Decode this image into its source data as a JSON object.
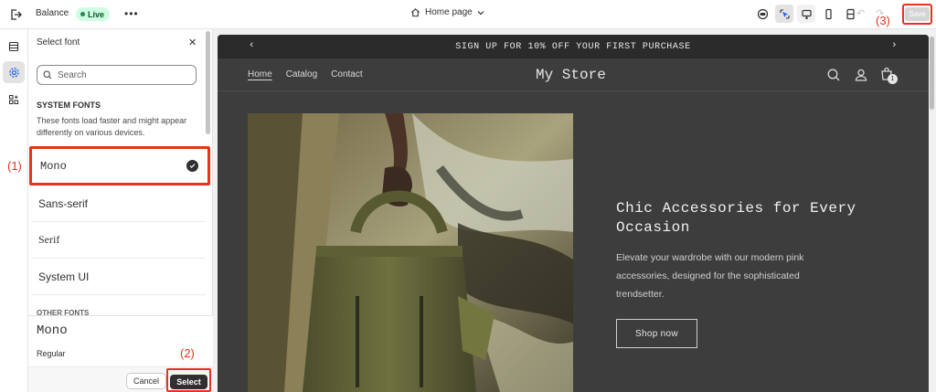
{
  "topbar": {
    "theme_name": "Balance",
    "status_badge": "Live",
    "more_label": "•••",
    "page_selector": "Home page",
    "save_label": "Save"
  },
  "font_panel": {
    "title": "Select font",
    "close_label": "✕",
    "search_placeholder": "Search",
    "system_fonts_heading": "SYSTEM FONTS",
    "system_fonts_description": "These fonts load faster and might appear differently on various devices.",
    "options": [
      "Mono",
      "Sans-serif",
      "Serif",
      "System UI"
    ],
    "selected_option": "Mono",
    "other_fonts_heading": "OTHER FONTS",
    "preview_font_name": "Mono",
    "preview_style": "Regular",
    "cancel_label": "Cancel",
    "select_label": "Select"
  },
  "annotations": {
    "step1": "(1)",
    "step2": "(2)",
    "step3": "(3)"
  },
  "store": {
    "announcement": "SIGN UP FOR 10% OFF YOUR FIRST PURCHASE",
    "nav": [
      "Home",
      "Catalog",
      "Contact"
    ],
    "store_name": "My Store",
    "cart_count": "1",
    "hero_heading": "Chic Accessories for Every Occasion",
    "hero_text": "Elevate your wardrobe with our modern pink accessories, designed for the sophisticated trendsetter.",
    "hero_button": "Shop now"
  },
  "colors": {
    "annotation_red": "#e8321e",
    "live_badge_bg": "#cdfee1",
    "store_bg": "#3d3d3d"
  }
}
